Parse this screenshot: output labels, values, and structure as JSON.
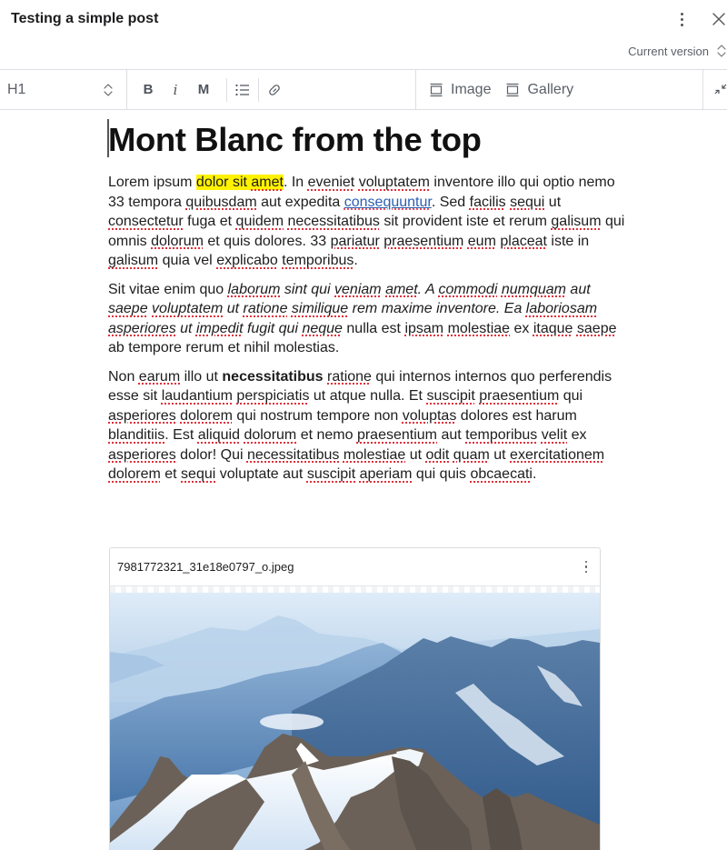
{
  "header": {
    "title": "Testing a simple post",
    "more_icon": "vertical-ellipsis-icon",
    "close_icon": "close-x-icon",
    "version_label": "Current version",
    "version_icon": "chevron-up-down-icon"
  },
  "toolbar": {
    "block_style": "H1",
    "block_style_icon": "chevron-up-down-icon",
    "bold_label": "B",
    "italic_label": "i",
    "mono_label": "M",
    "list_icon": "bulleted-list-icon",
    "link_icon": "link-icon",
    "image_label": "Image",
    "image_icon": "image-block-icon",
    "gallery_label": "Gallery",
    "gallery_icon": "gallery-block-icon",
    "collapse_icon": "collapse-arrows-icon"
  },
  "post": {
    "title": "Mont Blanc from the top",
    "paragraphs": [
      {
        "segments": [
          {
            "t": "Lorem ipsum "
          },
          {
            "t": "dolor sit ",
            "hl": true
          },
          {
            "t": "amet",
            "hl": true,
            "sp": true
          },
          {
            "t": ". In "
          },
          {
            "t": "eveniet",
            "sp": true
          },
          {
            "t": " "
          },
          {
            "t": "voluptatem",
            "sp": true
          },
          {
            "t": " inventore illo qui optio nemo 33 tempora "
          },
          {
            "t": "quibusdam",
            "sp": true
          },
          {
            "t": " aut expedita "
          },
          {
            "t": "consequuntur",
            "link": true
          },
          {
            "t": ". Sed "
          },
          {
            "t": "facilis",
            "sp": true
          },
          {
            "t": " "
          },
          {
            "t": "sequi",
            "sp": true
          },
          {
            "t": " ut "
          },
          {
            "t": "consectetur",
            "sp": true
          },
          {
            "t": " fuga et "
          },
          {
            "t": "quidem",
            "sp": true
          },
          {
            "t": " "
          },
          {
            "t": "necessitatibus",
            "sp": true
          },
          {
            "t": " sit provident iste et rerum "
          },
          {
            "t": "galisum",
            "sp": true
          },
          {
            "t": " qui omnis "
          },
          {
            "t": "dolorum",
            "sp": true
          },
          {
            "t": " et quis dolores. 33 "
          },
          {
            "t": "pariatur",
            "sp": true
          },
          {
            "t": " "
          },
          {
            "t": "praesentium",
            "sp": true
          },
          {
            "t": " "
          },
          {
            "t": "eum",
            "sp": true
          },
          {
            "t": " "
          },
          {
            "t": "placeat",
            "sp": true
          },
          {
            "t": " iste in "
          },
          {
            "t": "galisum",
            "sp": true
          },
          {
            "t": " quia vel "
          },
          {
            "t": "explicabo",
            "sp": true
          },
          {
            "t": " "
          },
          {
            "t": "temporibus",
            "sp": true
          },
          {
            "t": "."
          }
        ]
      },
      {
        "segments": [
          {
            "t": "Sit vitae enim quo "
          },
          {
            "t": "laborum",
            "em": true,
            "sp": true
          },
          {
            "t": " sint qui ",
            "em": true
          },
          {
            "t": "veniam",
            "em": true,
            "sp": true
          },
          {
            "t": " ",
            "em": true
          },
          {
            "t": "amet",
            "em": true,
            "sp": true
          },
          {
            "t": ". A ",
            "em": true
          },
          {
            "t": "commodi",
            "em": true,
            "sp": true
          },
          {
            "t": " ",
            "em": true
          },
          {
            "t": "numquam",
            "em": true,
            "sp": true
          },
          {
            "t": " aut ",
            "em": true
          },
          {
            "t": "saepe",
            "em": true,
            "sp": true
          },
          {
            "t": " ",
            "em": true
          },
          {
            "t": "voluptatem",
            "em": true,
            "sp": true
          },
          {
            "t": " ut ",
            "em": true
          },
          {
            "t": "ratione",
            "em": true,
            "sp": true
          },
          {
            "t": " ",
            "em": true
          },
          {
            "t": "similique",
            "em": true,
            "sp": true
          },
          {
            "t": " rem maxime inventore. Ea ",
            "em": true
          },
          {
            "t": "laboriosam",
            "em": true,
            "sp": true
          },
          {
            "t": " ",
            "em": true
          },
          {
            "t": "asperiores",
            "em": true,
            "sp": true
          },
          {
            "t": " ut ",
            "em": true
          },
          {
            "t": "impedit",
            "em": true,
            "sp": true
          },
          {
            "t": " fugit qui ",
            "em": true
          },
          {
            "t": "neque",
            "em": true,
            "sp": true
          },
          {
            "t": " nulla est "
          },
          {
            "t": "ipsam",
            "sp": true
          },
          {
            "t": " "
          },
          {
            "t": "molestiae",
            "sp": true
          },
          {
            "t": " ex "
          },
          {
            "t": "itaque",
            "sp": true
          },
          {
            "t": " "
          },
          {
            "t": "saepe",
            "sp": true
          },
          {
            "t": " ab tempore rerum et nihil molestias."
          }
        ]
      },
      {
        "segments": [
          {
            "t": "Non "
          },
          {
            "t": "earum",
            "sp": true
          },
          {
            "t": " illo ut "
          },
          {
            "t": "necessitatibus",
            "strong": true
          },
          {
            "t": " "
          },
          {
            "t": "ratione",
            "sp": true
          },
          {
            "t": " qui internos internos quo perferendis esse sit "
          },
          {
            "t": "laudantium",
            "sp": true
          },
          {
            "t": " "
          },
          {
            "t": "perspiciatis",
            "sp": true
          },
          {
            "t": " ut atque nulla. Et "
          },
          {
            "t": "suscipit",
            "sp": true
          },
          {
            "t": " "
          },
          {
            "t": "praesentium",
            "sp": true
          },
          {
            "t": " qui "
          },
          {
            "t": "asperiores",
            "sp": true
          },
          {
            "t": " "
          },
          {
            "t": "dolorem",
            "sp": true
          },
          {
            "t": " qui nostrum tempore non "
          },
          {
            "t": "voluptas",
            "sp": true
          },
          {
            "t": " dolores est harum "
          },
          {
            "t": "blanditiis",
            "sp": true
          },
          {
            "t": ". Est "
          },
          {
            "t": "aliquid",
            "sp": true
          },
          {
            "t": " "
          },
          {
            "t": "dolorum",
            "sp": true
          },
          {
            "t": " et nemo "
          },
          {
            "t": "praesentium",
            "sp": true
          },
          {
            "t": " aut "
          },
          {
            "t": "temporibus",
            "sp": true
          },
          {
            "t": " "
          },
          {
            "t": "velit",
            "sp": true
          },
          {
            "t": " ex "
          },
          {
            "t": "asperiores",
            "sp": true
          },
          {
            "t": " dolor! Qui "
          },
          {
            "t": "necessitatibus",
            "sp": true
          },
          {
            "t": " "
          },
          {
            "t": "molestiae",
            "sp": true
          },
          {
            "t": " ut "
          },
          {
            "t": "odit",
            "sp": true
          },
          {
            "t": " "
          },
          {
            "t": "quam",
            "sp": true
          },
          {
            "t": " ut "
          },
          {
            "t": "exercitationem",
            "sp": true
          },
          {
            "t": " "
          },
          {
            "t": "dolorem",
            "sp": true
          },
          {
            "t": " et "
          },
          {
            "t": "sequi",
            "sp": true
          },
          {
            "t": " voluptate aut "
          },
          {
            "t": "suscipit",
            "sp": true
          },
          {
            "t": " "
          },
          {
            "t": "aperiam",
            "sp": true
          },
          {
            "t": " qui quis "
          },
          {
            "t": "obcaecati",
            "sp": true
          },
          {
            "t": "."
          }
        ]
      }
    ]
  },
  "image_block": {
    "filename": "7981772321_31e18e0797_o.jpeg",
    "menu_icon": "vertical-ellipsis-icon",
    "photo_subject": "snow-covered alpine mountain peaks under blue haze",
    "colors": {
      "sky": "#dbe9f6",
      "haze": "#8fb3d6",
      "ridge_far": "#5f89b8",
      "ridge_mid": "#3e6797",
      "rock": "#6d6258",
      "snow": "#f2f7fd"
    }
  },
  "colors": {
    "highlight": "#fff200",
    "link": "#2b5fb3",
    "spellcheck": "#e0303a",
    "border": "#dcdee3",
    "toolbar_text": "#5b6068"
  }
}
